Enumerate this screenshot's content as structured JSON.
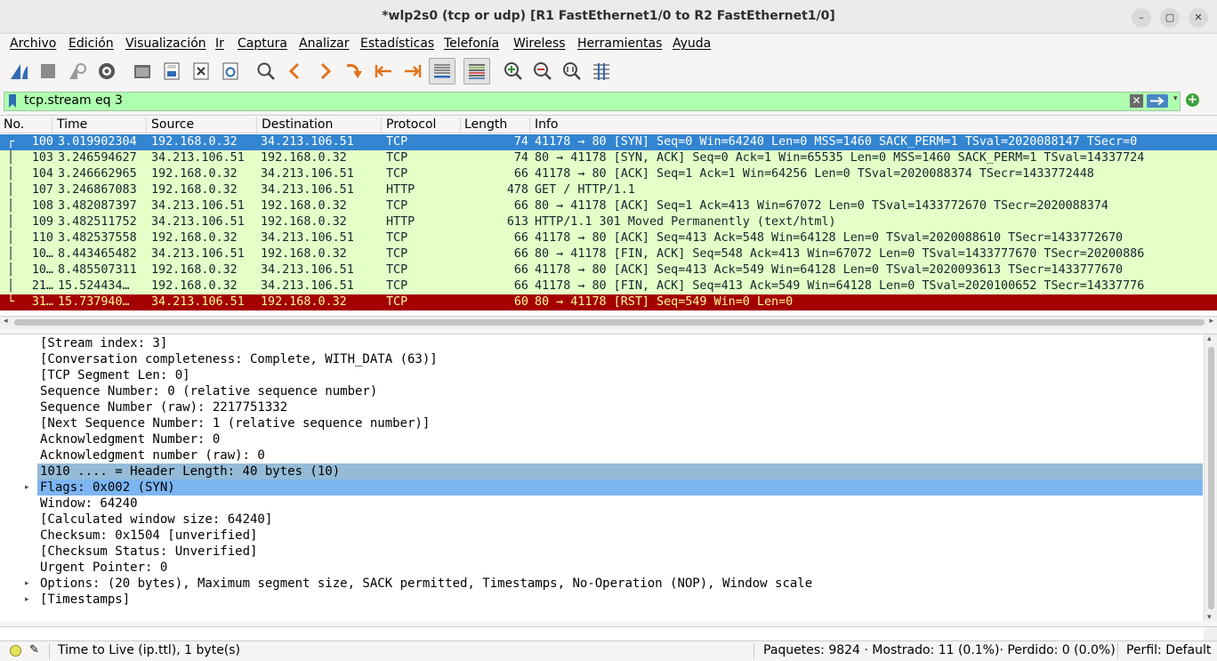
{
  "window": {
    "title": "*wlp2s0 (tcp or udp) [R1 FastEthernet1/0 to R2 FastEthernet1/0]",
    "controls": {
      "minimize": "–",
      "maximize": "▢",
      "close": "✕"
    }
  },
  "menu": [
    "Archivo",
    "Edición",
    "Visualización",
    "Ir",
    "Captura",
    "Analizar",
    "Estadísticas",
    "Telefonía",
    "Wireless",
    "Herramientas",
    "Ayuda"
  ],
  "toolbar": {
    "buttons": [
      "start-capture-icon",
      "stop-capture-icon",
      "restart-capture-icon",
      "capture-options-icon",
      "open-file-icon",
      "save-file-icon",
      "close-file-icon",
      "reload-file-icon",
      "find-packet-icon",
      "go-back-icon",
      "go-forward-icon",
      "go-to-packet-icon",
      "go-first-icon",
      "go-last-icon",
      "autoscroll-icon",
      "colorize-icon",
      "zoom-in-icon",
      "zoom-out-icon",
      "normal-size-icon",
      "resize-columns-icon"
    ],
    "colors": {
      "shark_blue": "#2f6bb3",
      "arrow_orange": "#e0731d",
      "zoom_green": "#2e8b2e"
    }
  },
  "filter": {
    "value": "tcp.stream eq 3",
    "background": "#afffaf",
    "clear_icon": "✕",
    "dropdown_icon": "▾",
    "add_icon": "+"
  },
  "packet_list": {
    "columns": [
      "No.",
      "Time",
      "Source",
      "Destination",
      "Protocol",
      "Length",
      "Info"
    ],
    "rows": [
      {
        "line": "┌",
        "no": "100",
        "time": "3.019902304",
        "src": "192.168.0.32",
        "dst": "34.213.106.51",
        "proto": "TCP",
        "len": "74",
        "info": "41178 → 80 [SYN] Seq=0 Win=64240 Len=0 MSS=1460 SACK_PERM=1 TSval=2020088147 TSecr=0",
        "style": "sel"
      },
      {
        "line": "│",
        "no": "103",
        "time": "3.246594627",
        "src": "34.213.106.51",
        "dst": "192.168.0.32",
        "proto": "TCP",
        "len": "74",
        "info": "80 → 41178 [SYN, ACK] Seq=0 Ack=1 Win=65535 Len=0 MSS=1460 SACK_PERM=1 TSval=14337724",
        "style": "green"
      },
      {
        "line": "│",
        "no": "104",
        "time": "3.246662965",
        "src": "192.168.0.32",
        "dst": "34.213.106.51",
        "proto": "TCP",
        "len": "66",
        "info": "41178 → 80 [ACK] Seq=1 Ack=1 Win=64256 Len=0 TSval=2020088374 TSecr=1433772448",
        "style": "green"
      },
      {
        "line": "│",
        "no": "107",
        "time": "3.246867083",
        "src": "192.168.0.32",
        "dst": "34.213.106.51",
        "proto": "HTTP",
        "len": "478",
        "info": "GET / HTTP/1.1",
        "style": "green"
      },
      {
        "line": "│",
        "no": "108",
        "time": "3.482087397",
        "src": "34.213.106.51",
        "dst": "192.168.0.32",
        "proto": "TCP",
        "len": "66",
        "info": "80 → 41178 [ACK] Seq=1 Ack=413 Win=67072 Len=0 TSval=1433772670 TSecr=2020088374",
        "style": "green"
      },
      {
        "line": "│",
        "no": "109",
        "time": "3.482511752",
        "src": "34.213.106.51",
        "dst": "192.168.0.32",
        "proto": "HTTP",
        "len": "613",
        "info": "HTTP/1.1 301 Moved Permanently  (text/html)",
        "style": "green"
      },
      {
        "line": "│",
        "no": "110",
        "time": "3.482537558",
        "src": "192.168.0.32",
        "dst": "34.213.106.51",
        "proto": "TCP",
        "len": "66",
        "info": "41178 → 80 [ACK] Seq=413 Ack=548 Win=64128 Len=0 TSval=2020088610 TSecr=1433772670",
        "style": "green"
      },
      {
        "line": "│",
        "no": "10…",
        "time": "8.443465482",
        "src": "34.213.106.51",
        "dst": "192.168.0.32",
        "proto": "TCP",
        "len": "66",
        "info": "80 → 41178 [FIN, ACK] Seq=548 Ack=413 Win=67072 Len=0 TSval=1433777670 TSecr=20200886",
        "style": "green"
      },
      {
        "line": "│",
        "no": "10…",
        "time": "8.485507311",
        "src": "192.168.0.32",
        "dst": "34.213.106.51",
        "proto": "TCP",
        "len": "66",
        "info": "41178 → 80 [ACK] Seq=413 Ack=549 Win=64128 Len=0 TSval=2020093613 TSecr=1433777670",
        "style": "green"
      },
      {
        "line": "│",
        "no": "21…",
        "time": "15.524434…",
        "src": "192.168.0.32",
        "dst": "34.213.106.51",
        "proto": "TCP",
        "len": "66",
        "info": "41178 → 80 [FIN, ACK] Seq=413 Ack=549 Win=64128 Len=0 TSval=2020100652 TSecr=14337776",
        "style": "green"
      },
      {
        "line": "└",
        "no": "31…",
        "time": "15.737940…",
        "src": "34.213.106.51",
        "dst": "192.168.0.32",
        "proto": "TCP",
        "len": "60",
        "info": "80 → 41178 [RST] Seq=549 Win=0 Len=0",
        "style": "rst"
      }
    ],
    "colors": {
      "selected": "#3385d1",
      "tcp_green": "#e4ffc7",
      "rst_red": "#a40000",
      "rst_text": "#fffc9c"
    }
  },
  "details": {
    "lines": [
      {
        "text": "[Stream index: 3]",
        "expander": "",
        "hl": ""
      },
      {
        "text": "[Conversation completeness: Complete, WITH_DATA (63)]",
        "expander": "",
        "hl": ""
      },
      {
        "text": "[TCP Segment Len: 0]",
        "expander": "",
        "hl": ""
      },
      {
        "text": "Sequence Number: 0    (relative sequence number)",
        "expander": "",
        "hl": ""
      },
      {
        "text": "Sequence Number (raw): 2217751332",
        "expander": "",
        "hl": ""
      },
      {
        "text": "[Next Sequence Number: 1    (relative sequence number)]",
        "expander": "",
        "hl": ""
      },
      {
        "text": "Acknowledgment Number: 0",
        "expander": "",
        "hl": ""
      },
      {
        "text": "Acknowledgment number (raw): 0",
        "expander": "",
        "hl": ""
      },
      {
        "text": "1010 .... = Header Length: 40 bytes (10)",
        "expander": "",
        "hl": "hl1"
      },
      {
        "text": "Flags: 0x002 (SYN)",
        "expander": "▸",
        "hl": "hl2"
      },
      {
        "text": "Window: 64240",
        "expander": "",
        "hl": ""
      },
      {
        "text": "[Calculated window size: 64240]",
        "expander": "",
        "hl": ""
      },
      {
        "text": "Checksum: 0x1504 [unverified]",
        "expander": "",
        "hl": ""
      },
      {
        "text": "[Checksum Status: Unverified]",
        "expander": "",
        "hl": ""
      },
      {
        "text": "Urgent Pointer: 0",
        "expander": "",
        "hl": ""
      },
      {
        "text": "Options: (20 bytes), Maximum segment size, SACK permitted, Timestamps, No-Operation (NOP), Window scale",
        "expander": "▸",
        "hl": ""
      },
      {
        "text": "[Timestamps]",
        "expander": "▸",
        "hl": ""
      }
    ]
  },
  "status": {
    "field": "Time to Live (ip.ttl), 1 byte(s)",
    "counts": "Paquetes: 9824 · Mostrado: 11 (0.1%)· Perdido: 0 (0.0%)",
    "profile": "Perfil: Default"
  }
}
